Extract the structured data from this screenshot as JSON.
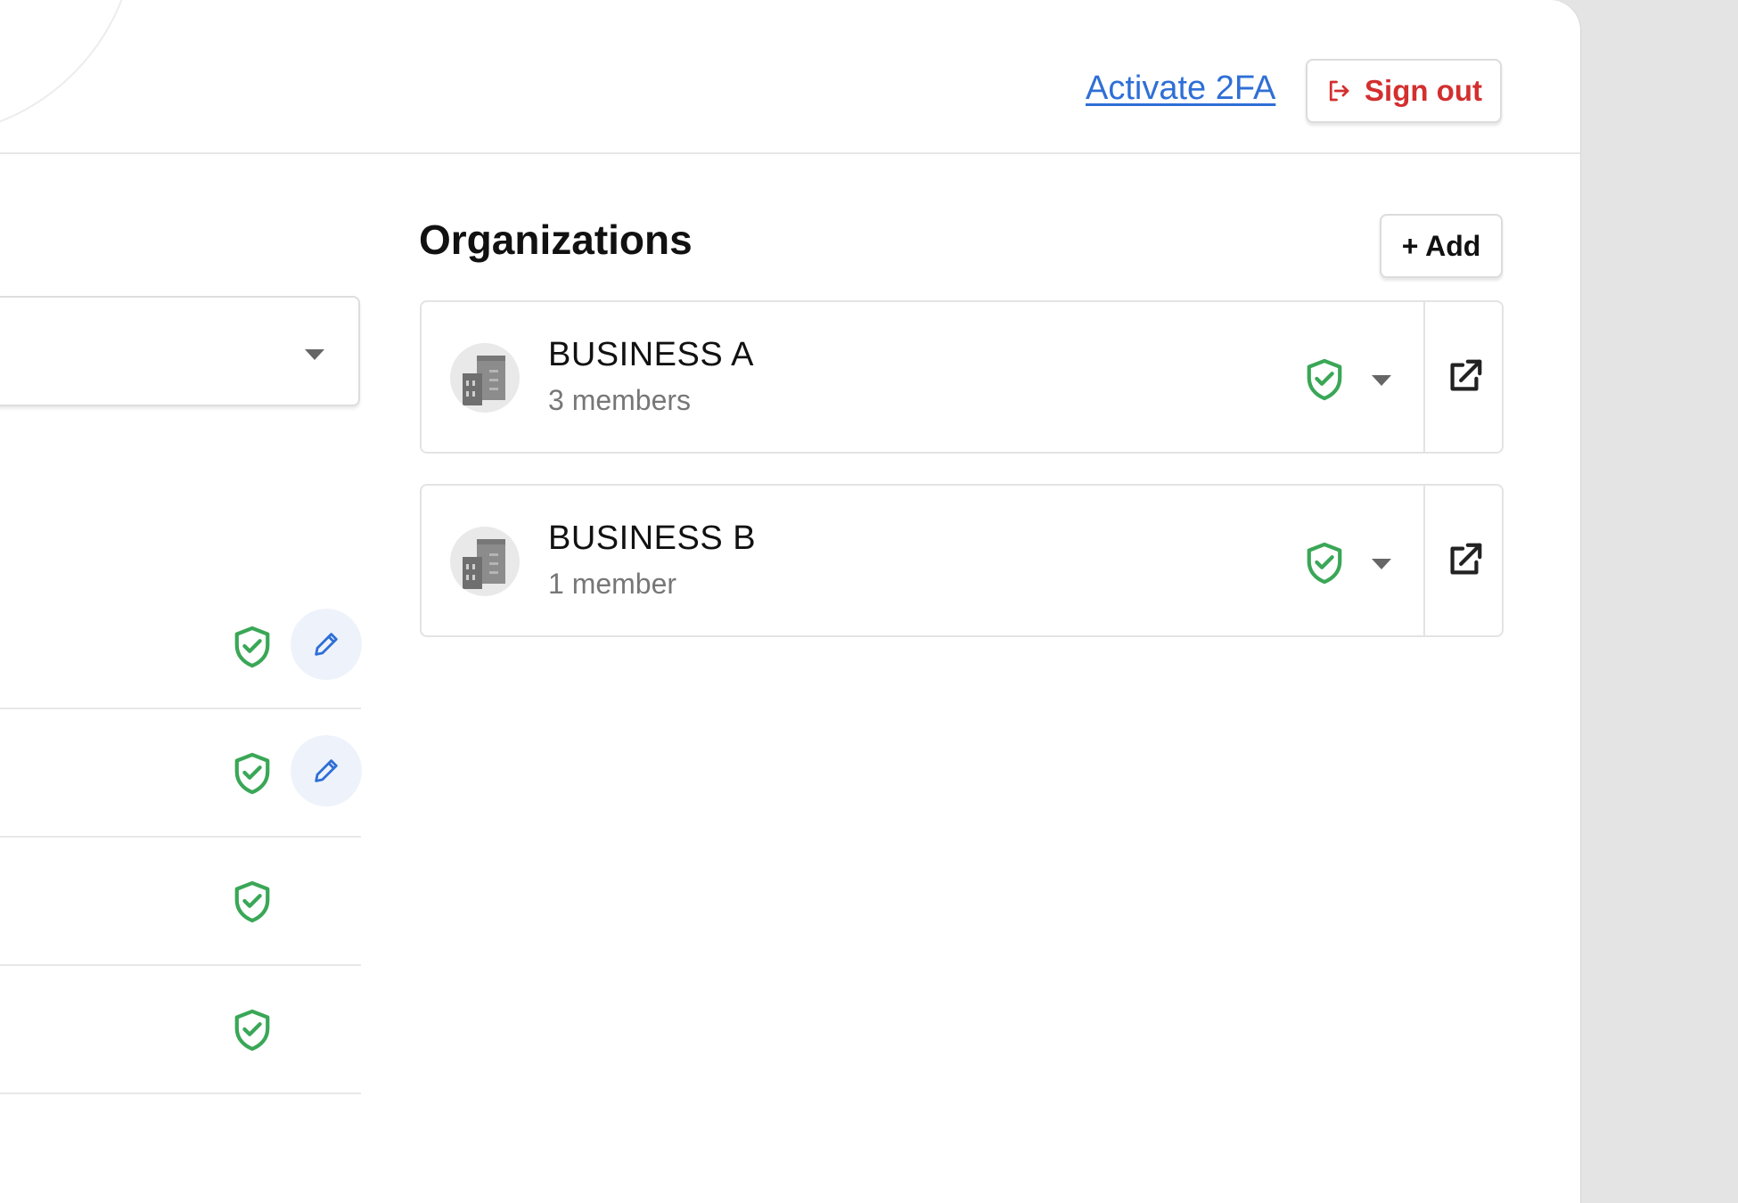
{
  "header": {
    "activate_2fa_label": "Activate 2FA",
    "sign_out_label": "Sign out",
    "link_color": "#2f6fd6",
    "danger_color": "#d32f2f"
  },
  "organizations": {
    "title": "Organizations",
    "add_label": "+ Add",
    "items": [
      {
        "name": "BUSINESS A",
        "members": "3 members",
        "verified_icon": "shield-check-icon"
      },
      {
        "name": "BUSINESS B",
        "members": "1 member",
        "verified_icon": "shield-check-icon"
      }
    ]
  },
  "left_column": {
    "rows": [
      {
        "verified_icon": "shield-check-icon",
        "editable": true
      },
      {
        "verified_icon": "shield-check-icon",
        "editable": true
      },
      {
        "verified_icon": "shield-check-icon",
        "editable": false
      },
      {
        "verified_icon": "shield-check-icon",
        "editable": false
      }
    ]
  },
  "colors": {
    "verified_green": "#3aa757",
    "edit_blue": "#2f6fd6"
  }
}
